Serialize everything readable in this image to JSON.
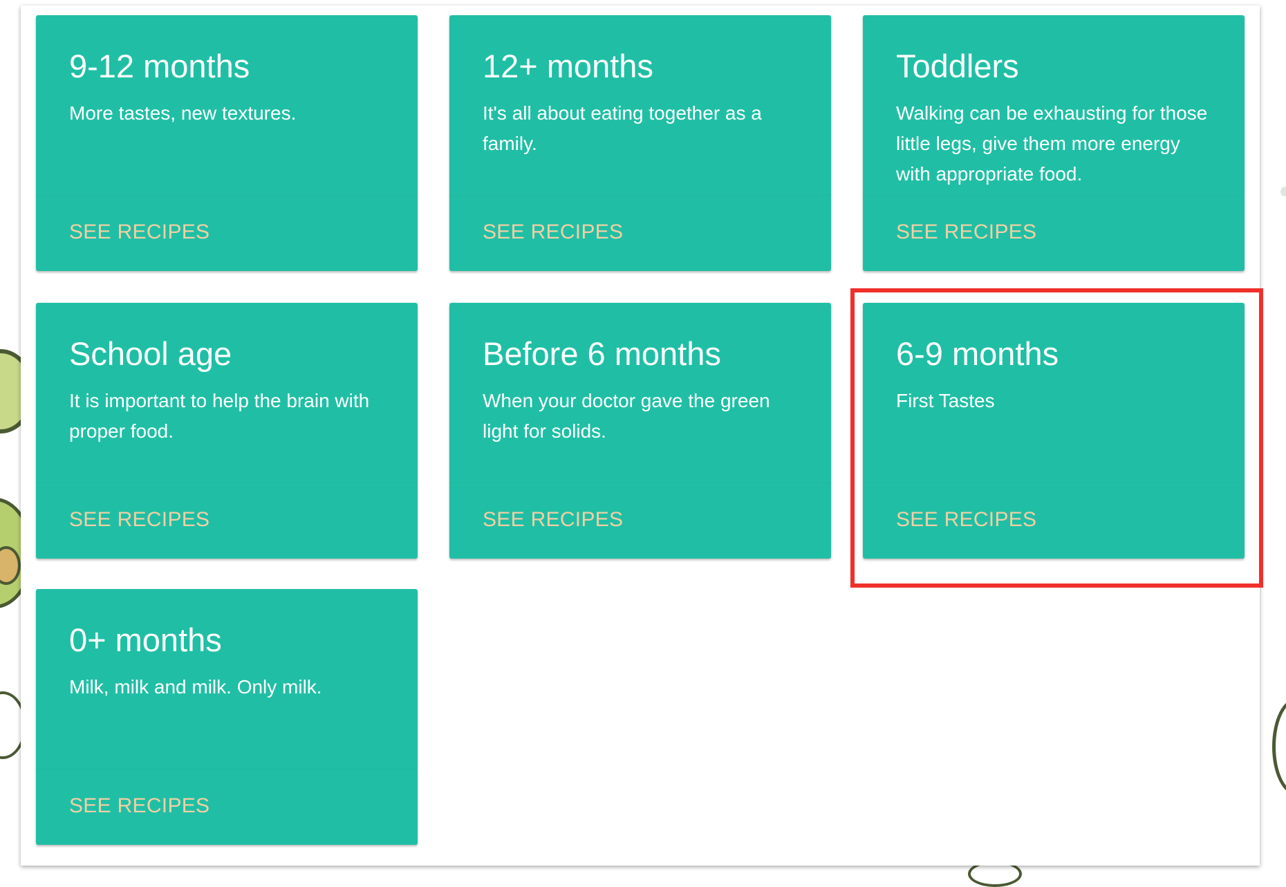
{
  "cards": [
    {
      "title": "9-12 months",
      "description": "More tastes, new textures.",
      "action": "SEE RECIPES"
    },
    {
      "title": "12+ months",
      "description": "It's all about eating together as a family.",
      "action": "SEE RECIPES"
    },
    {
      "title": "Toddlers",
      "description": "Walking can be exhausting for those little legs, give them more energy with appropriate food.",
      "action": "SEE RECIPES"
    },
    {
      "title": "School age",
      "description": "It is important to help the brain with proper food.",
      "action": "SEE RECIPES"
    },
    {
      "title": "Before 6 months",
      "description": "When your doctor gave the green light for solids.",
      "action": "SEE RECIPES"
    },
    {
      "title": "6-9 months",
      "description": "First Tastes",
      "action": "SEE RECIPES"
    },
    {
      "title": "0+ months",
      "description": "Milk, milk and milk. Only milk.",
      "action": "SEE RECIPES"
    }
  ],
  "colors": {
    "card_background": "#20bfa5",
    "card_text": "#ffffff",
    "action_text": "#f2cfa4",
    "highlight_border": "#f0302a"
  },
  "highlighted_card": "6-9 months"
}
